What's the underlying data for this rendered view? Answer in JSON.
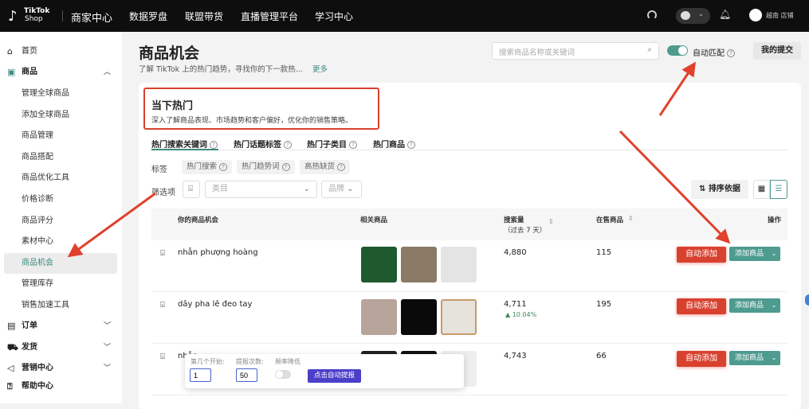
{
  "topbar": {
    "logo_top": "TikTok",
    "logo_bottom": "Shop",
    "center_title": "商家中心",
    "nav": [
      "数据罗盘",
      "联盟带货",
      "直播管理平台",
      "学习中心"
    ],
    "store": "越南 店铺"
  },
  "sidebar": {
    "home": "首页",
    "product": "商品",
    "product_items": [
      "管理全球商品",
      "添加全球商品",
      "商品管理",
      "商品搭配",
      "商品优化工具",
      "价格诊断",
      "商品评分",
      "素材中心",
      "商品机会",
      "管理库存",
      "销售加速工具"
    ],
    "orders": "订单",
    "shipping": "发货",
    "marketing": "营销中心",
    "help": "帮助中心"
  },
  "header": {
    "title": "商品机会",
    "subtitle": "了解 TikTok 上的热门趋势，寻找你的下一款热...",
    "more": "更多",
    "search_placeholder": "搜索商品名称或关键词",
    "auto_match": "自动匹配",
    "auto_match_on": true,
    "my_submissions": "我的提交"
  },
  "hot": {
    "title": "当下热门",
    "desc": "深入了解商品表现、市场趋势和客户偏好，优化你的销售策略。"
  },
  "tabs": [
    "热门搜索关键词",
    "热门话题标签",
    "热门子类目",
    "热门商品"
  ],
  "tags": {
    "label": "标签",
    "items": [
      "热门搜索",
      "热门趋势词",
      "高热缺货"
    ]
  },
  "filters": {
    "label": "筛选项",
    "category_placeholder": "类目",
    "brand_placeholder": "品牌",
    "sort": "排序依据"
  },
  "table": {
    "headers": {
      "opportunity": "你的商品机会",
      "related": "相关商品",
      "search_volume": "搜索量",
      "search_volume_sub": "（过去 7 天）",
      "on_sale": "在售商品",
      "actions": "操作"
    },
    "rows": [
      {
        "name": "nhẫn phượng hoàng",
        "search": "4,880",
        "change": "",
        "on_sale": "115"
      },
      {
        "name": "dây pha lê đeo tay",
        "search": "4,711",
        "change": "▲ 10.04%",
        "on_sale": "195"
      },
      {
        "name": "nhẫn",
        "search": "4,743",
        "change": "",
        "on_sale": "66"
      }
    ],
    "auto_add": "自动添加",
    "add_product": "添加商品"
  },
  "popup": {
    "start_label": "第几个开始:",
    "start_value": "1",
    "count_label": "提报次数:",
    "count_value": "50",
    "freq_label": "频率降低",
    "submit": "点击自动提报"
  },
  "colors": {
    "accent": "#4e9b8f",
    "red": "#d9412f",
    "popup_btn": "#4b3fc9"
  }
}
